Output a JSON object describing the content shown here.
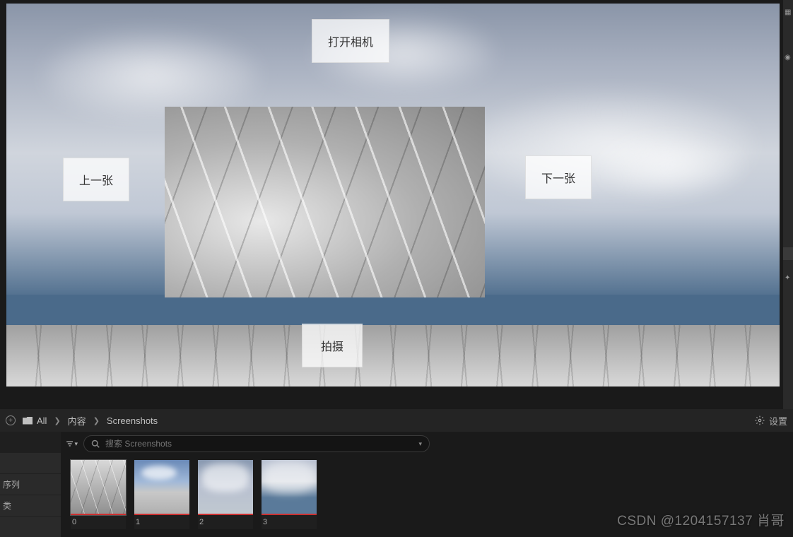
{
  "viewport": {
    "buttons": {
      "open_camera": "打开相机",
      "prev": "上一张",
      "next": "下一张",
      "capture": "拍摄"
    }
  },
  "breadcrumb": {
    "all": "All",
    "content": "内容",
    "folder": "Screenshots"
  },
  "settings_label": "设置",
  "left_tree": {
    "row1": "",
    "row2": "",
    "row3": "序列",
    "row4": "类",
    "row5": ""
  },
  "search": {
    "placeholder": "搜索 Screenshots"
  },
  "thumbnails": [
    {
      "label": "0"
    },
    {
      "label": "1"
    },
    {
      "label": "2"
    },
    {
      "label": "3"
    }
  ],
  "watermark": "CSDN @1204157137 肖哥"
}
